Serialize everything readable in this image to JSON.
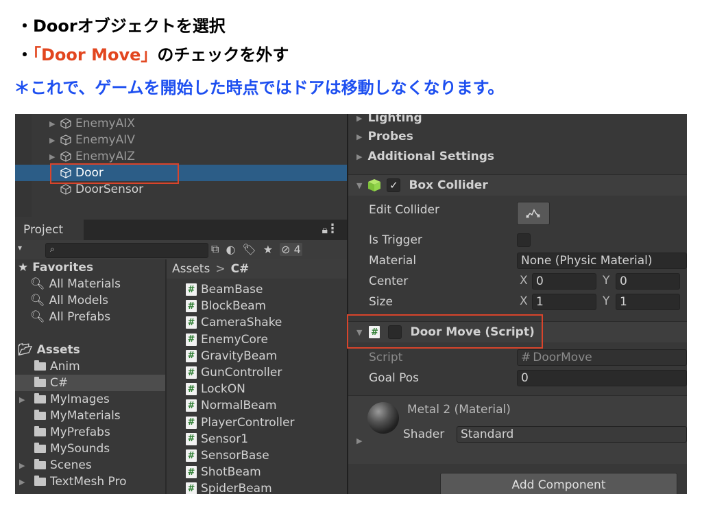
{
  "annotations": {
    "line1": "・Doorオブジェクトを選択",
    "line2_prefix": "・",
    "line2_highlight": "「Door Move」",
    "line2_suffix": "のチェックを外す",
    "line3": "＊これで、ゲームを開始した時点ではドアは移動しなくなります。"
  },
  "colors": {
    "highlight_red": "#d9442b",
    "note_blue": "#1d4ff0",
    "selection_blue": "#2c5d87"
  },
  "hierarchy": {
    "items": [
      {
        "label": "EnemyAIX",
        "expandable": true
      },
      {
        "label": "EnemyAIV",
        "expandable": true
      },
      {
        "label": "EnemyAIZ",
        "expandable": true
      },
      {
        "label": "Door",
        "expandable": false,
        "selected": true
      },
      {
        "label": "DoorSensor",
        "expandable": false
      }
    ]
  },
  "project": {
    "tab_label": "Project",
    "search_placeholder": "",
    "hidden_count": "4",
    "favorites_label": "Favorites",
    "favorites": [
      "All Materials",
      "All Models",
      "All Prefabs"
    ],
    "assets_label": "Assets",
    "folders": [
      {
        "label": "Anim",
        "expandable": false
      },
      {
        "label": "C#",
        "expandable": false,
        "selected": true
      },
      {
        "label": "MyImages",
        "expandable": true
      },
      {
        "label": "MyMaterials",
        "expandable": false
      },
      {
        "label": "MyPrefabs",
        "expandable": false
      },
      {
        "label": "MySounds",
        "expandable": false
      },
      {
        "label": "Scenes",
        "expandable": true
      },
      {
        "label": "TextMesh Pro",
        "expandable": true
      }
    ],
    "breadcrumb_root": "Assets",
    "breadcrumb_sep": ">",
    "breadcrumb_current": "C#",
    "files": [
      "BeamBase",
      "BlockBeam",
      "CameraShake",
      "EnemyCore",
      "GravityBeam",
      "GunController",
      "LockON",
      "NormalBeam",
      "PlayerController",
      "Sensor1",
      "SensorBase",
      "ShotBeam",
      "SpiderBeam"
    ]
  },
  "inspector": {
    "lighting": "Lighting",
    "probes": "Probes",
    "additional_settings": "Additional Settings",
    "box_collider": {
      "title": "Box Collider",
      "enabled": true,
      "edit_collider_label": "Edit Collider",
      "is_trigger_label": "Is Trigger",
      "is_trigger": false,
      "material_label": "Material",
      "material_value": "None (Physic Material)",
      "center_label": "Center",
      "center_x": "0",
      "center_y": "0",
      "size_label": "Size",
      "size_x": "1",
      "size_y": "1",
      "axis_x": "X",
      "axis_y": "Y"
    },
    "door_move": {
      "title": "Door Move (Script)",
      "enabled": false,
      "script_label": "Script",
      "script_value": "DoorMove",
      "goal_pos_label": "Goal Pos",
      "goal_pos_value": "0"
    },
    "material": {
      "name": "Metal 2 (Material)",
      "shader_label": "Shader",
      "shader_value": "Standard"
    },
    "add_component": "Add Component"
  }
}
